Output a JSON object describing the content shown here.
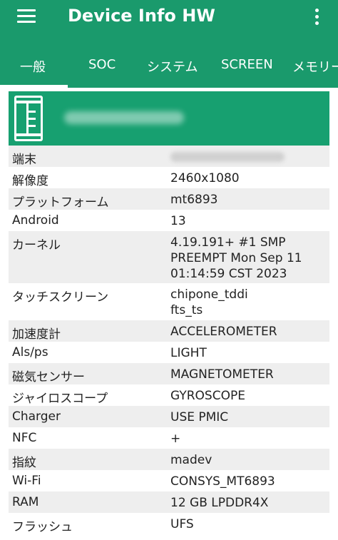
{
  "app": {
    "title": "Device Info HW",
    "colors": {
      "primary": "#1a9a6c",
      "header_card": "#17a070",
      "row_alt": "#eeeeee"
    }
  },
  "toolbar": {
    "menu_icon": "hamburger-menu-icon",
    "more_icon": "more-vert-icon"
  },
  "tabs": [
    {
      "label": "一般",
      "selected": true
    },
    {
      "label": "SOC",
      "selected": false
    },
    {
      "label": "システム",
      "selected": false
    },
    {
      "label": "SCREEN",
      "selected": false
    },
    {
      "label": "メモリー",
      "selected": false
    }
  ],
  "header": {
    "icon": "device-hardware-icon"
  },
  "rows": [
    {
      "label": "端末",
      "value": ""
    },
    {
      "label": "解像度",
      "value": "2460x1080"
    },
    {
      "label": "プラットフォーム",
      "value": "mt6893"
    },
    {
      "label": "Android",
      "value": "13"
    },
    {
      "label": "カーネル",
      "value": "4.19.191+ #1 SMP\nPREEMPT Mon Sep 11\n01:14:59 CST 2023"
    },
    {
      "label": "タッチスクリーン",
      "value": "chipone_tddi\nfts_ts"
    },
    {
      "label": "加速度計",
      "value": "ACCELEROMETER"
    },
    {
      "label": "Als/ps",
      "value": "LIGHT"
    },
    {
      "label": "磁気センサー",
      "value": "MAGNETOMETER"
    },
    {
      "label": "ジャイロスコープ",
      "value": "GYROSCOPE"
    },
    {
      "label": "Charger",
      "value": "USE PMIC"
    },
    {
      "label": "NFC",
      "value": "+"
    },
    {
      "label": "指紋",
      "value": "madev"
    },
    {
      "label": "Wi-Fi",
      "value": "CONSYS_MT6893"
    },
    {
      "label": "RAM",
      "value": "12 GB LPDDR4X"
    },
    {
      "label": "フラッシュ",
      "value": "UFS"
    }
  ]
}
